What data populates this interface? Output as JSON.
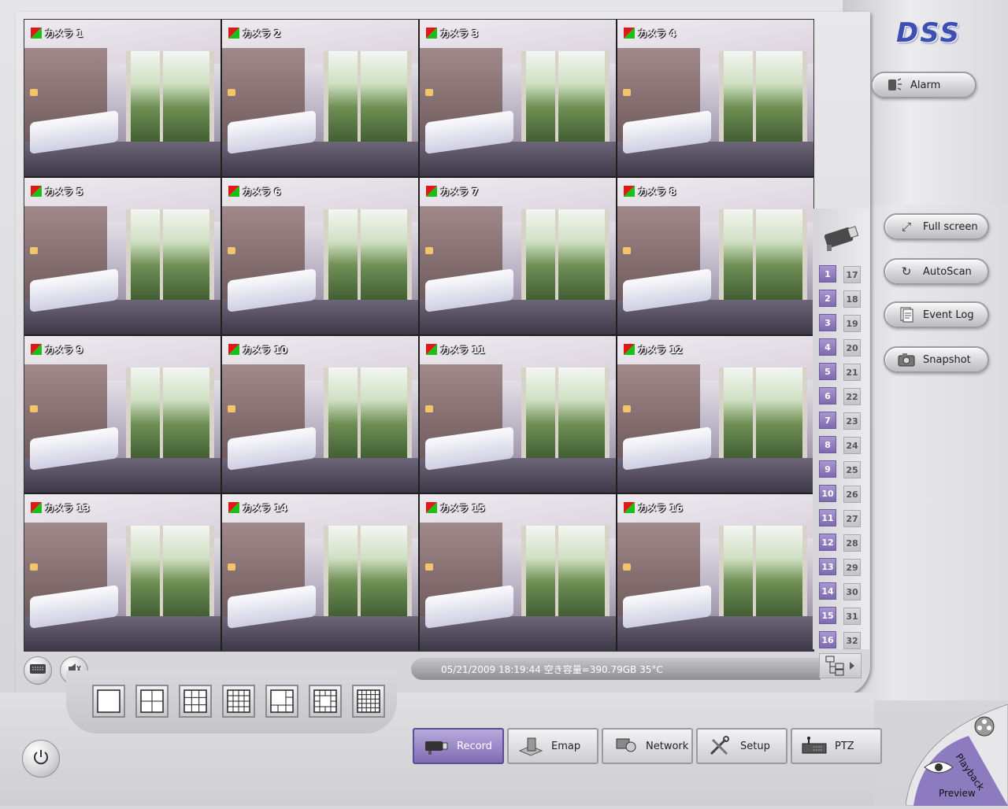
{
  "app": {
    "logo": "DSS"
  },
  "cameras": [
    {
      "label": "カメラ 1"
    },
    {
      "label": "カメラ 2"
    },
    {
      "label": "カメラ 3"
    },
    {
      "label": "カメラ 4"
    },
    {
      "label": "カメラ 5"
    },
    {
      "label": "カメラ 6"
    },
    {
      "label": "カメラ 7"
    },
    {
      "label": "カメラ 8"
    },
    {
      "label": "カメラ 9"
    },
    {
      "label": "カメラ 10"
    },
    {
      "label": "カメラ 11"
    },
    {
      "label": "カメラ 12"
    },
    {
      "label": "カメラ 13"
    },
    {
      "label": "カメラ 14"
    },
    {
      "label": "カメラ 15"
    },
    {
      "label": "カメラ 16"
    }
  ],
  "channels": {
    "active": [
      "1",
      "2",
      "3",
      "4",
      "5",
      "6",
      "7",
      "8",
      "9",
      "10",
      "11",
      "12",
      "13",
      "14",
      "15",
      "16"
    ],
    "inactive": [
      "17",
      "18",
      "19",
      "20",
      "21",
      "22",
      "23",
      "24",
      "25",
      "26",
      "27",
      "28",
      "29",
      "30",
      "31",
      "32"
    ]
  },
  "side_buttons": {
    "alarm": "Alarm",
    "full_screen": "Full screen",
    "autoscan": "AutoScan",
    "event_log": "Event Log",
    "snapshot": "Snapshot"
  },
  "status": {
    "text": "05/21/2009 18:19:44  空き容量=390.79GB 35°C"
  },
  "tabs": {
    "record": "Record",
    "emap": "Emap",
    "network": "Network",
    "setup": "Setup",
    "ptz": "PTZ"
  },
  "corner": {
    "playback": "Playback",
    "preview": "Preview"
  },
  "colors": {
    "accent": "#7d6aaf",
    "flag_red": "#e01818",
    "flag_green": "#18c018",
    "logo": "#3d4fb0"
  }
}
